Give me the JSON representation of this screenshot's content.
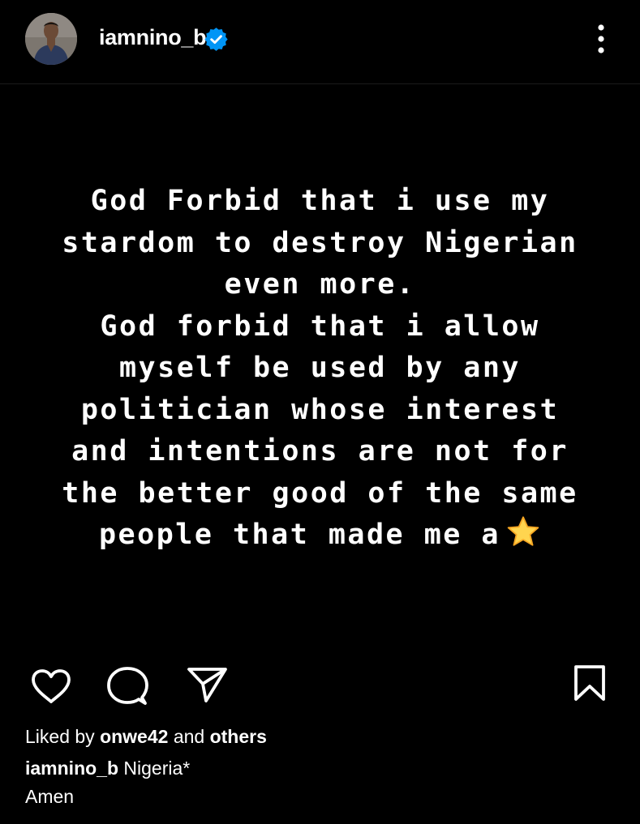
{
  "header": {
    "username": "iamnino_b",
    "verified": true,
    "avatar_icon": "profile-photo",
    "more_icon": "more-vertical-icon"
  },
  "post": {
    "background": "#000000",
    "text_color": "#ffffff",
    "lines": [
      "God Forbid that i use my",
      "stardom to destroy Nigerian",
      "even more.",
      "God forbid that i allow",
      "myself be used by any",
      "politician whose interest",
      "and intentions are not for",
      "the better good of the same",
      "people that made me a"
    ],
    "trailing_emoji": "star-emoji"
  },
  "actions": {
    "like_icon": "heart-icon",
    "comment_icon": "comment-icon",
    "share_icon": "send-icon",
    "save_icon": "bookmark-icon"
  },
  "likes": {
    "prefix": "Liked by",
    "user": "onwe42",
    "middle": "and",
    "others": "others"
  },
  "caption": {
    "username": "iamnino_b",
    "text": "Nigeria*",
    "second_line": "Amen"
  },
  "colors": {
    "verified_badge": "#0095f6",
    "star_fill": "#ffd54f"
  }
}
